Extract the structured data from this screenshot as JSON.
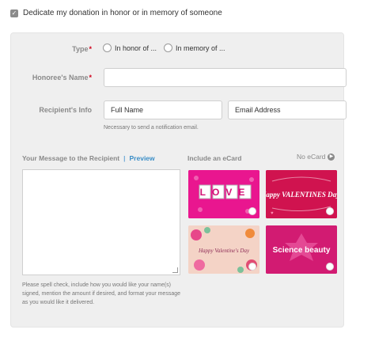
{
  "dedicate": {
    "checked": true,
    "label": "Dedicate my donation in honor or in memory of someone"
  },
  "form": {
    "type_label": "Type",
    "type_options": [
      "In honor of ...",
      "In memory of ..."
    ],
    "honoree_label": "Honoree's Name",
    "recipient_label": "Recipient's Info",
    "full_name_placeholder": "Full Name",
    "email_placeholder": "Email Address",
    "email_hint": "Necessary to send a notification email.",
    "required_mark": "*"
  },
  "message": {
    "title": "Your Message to the Recipient",
    "separator": "|",
    "preview": "Preview",
    "help": "Please spell check, include how you would like your name(s) signed, mention the amount if desired, and format your message as you would like it delivered."
  },
  "ecard": {
    "title": "Include an eCard",
    "no_ecard": "No eCard",
    "cards": [
      {
        "name": "love",
        "text": "LOVE"
      },
      {
        "name": "happy-valentines",
        "text": "Happy VALENTINES Day!"
      },
      {
        "name": "floral",
        "text": "Happy Valentine's Day"
      },
      {
        "name": "science",
        "text": "Science beauty"
      }
    ]
  }
}
